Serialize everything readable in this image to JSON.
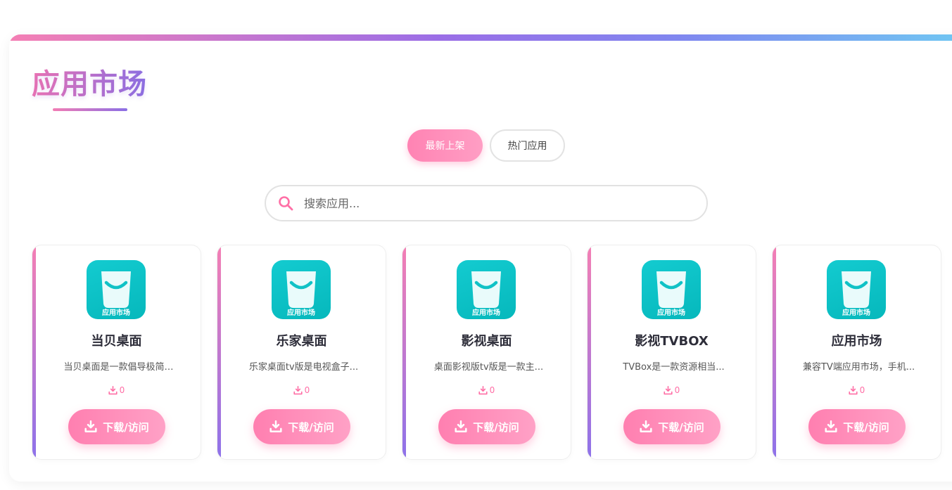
{
  "header": {
    "title": "应用市场"
  },
  "tabs": [
    {
      "label": "最新上架",
      "active": true
    },
    {
      "label": "热门应用",
      "active": false
    }
  ],
  "search": {
    "placeholder": "搜索应用...",
    "value": ""
  },
  "apps": [
    {
      "name": "当贝桌面",
      "desc": "当贝桌面是一款倡导极简…",
      "downloads": "0",
      "icon_caption": "应用市场",
      "button_label": "下载/访问"
    },
    {
      "name": "乐家桌面",
      "desc": "乐家桌面tv版是电视盒子...",
      "downloads": "0",
      "icon_caption": "应用市场",
      "button_label": "下载/访问"
    },
    {
      "name": "影视桌面",
      "desc": "桌面影视版tv版是一款主...",
      "downloads": "0",
      "icon_caption": "应用市场",
      "button_label": "下载/访问"
    },
    {
      "name": "影视TVBOX",
      "desc": "TVBox是一款资源相当...",
      "downloads": "0",
      "icon_caption": "应用市场",
      "button_label": "下载/访问"
    },
    {
      "name": "应用市场",
      "desc": "兼容TV端应用市场，手机...",
      "downloads": "0",
      "icon_caption": "应用市场",
      "button_label": "下载/访问"
    }
  ],
  "colors": {
    "accent_pink": "#ff83b3",
    "accent_purple": "#8a6ee2",
    "icon_teal": "#0dc2c6"
  },
  "icons": {
    "search": "search-icon",
    "download": "download-icon",
    "app": "shopping-bag-icon"
  }
}
